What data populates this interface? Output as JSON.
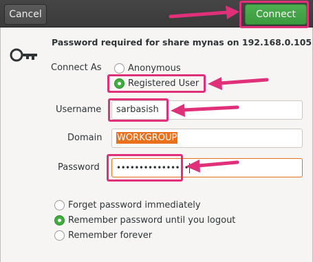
{
  "header": {
    "cancel_label": "Cancel",
    "connect_label": "Connect"
  },
  "dialog": {
    "heading": "Password required for share mynas on 192.168.0.105",
    "connect_as_label": "Connect As",
    "connect_as_options": [
      {
        "label": "Anonymous",
        "selected": false
      },
      {
        "label": "Registered User",
        "selected": true
      }
    ],
    "username_label": "Username",
    "username_value": "sarbasish",
    "domain_label": "Domain",
    "domain_value": "WORKGROUP",
    "password_label": "Password",
    "password_value": "••••••••••••••••",
    "remember_options": [
      {
        "label": "Forget password immediately",
        "selected": false
      },
      {
        "label": "Remember password until you logout",
        "selected": true
      },
      {
        "label": "Remember forever",
        "selected": false
      }
    ]
  },
  "icons": {
    "key": "key-icon"
  },
  "colors": {
    "accent_green": "#3fae3f",
    "focus_orange": "#e9711c",
    "annotation_pink": "#e0307a"
  }
}
